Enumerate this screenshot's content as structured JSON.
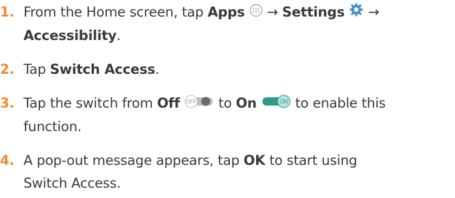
{
  "steps": [
    {
      "number": "1.",
      "t1": "From the Home screen, tap ",
      "b1": "Apps",
      "arrow1": "→",
      "b2": "Settings",
      "arrow2": "→",
      "b3": "Accessibility",
      "t2": "."
    },
    {
      "number": "2.",
      "t1": "Tap ",
      "b1": "Switch Access",
      "t2": "."
    },
    {
      "number": "3.",
      "t1": "Tap the switch from ",
      "b1": "Off",
      "toggle_off_text": "OFF",
      "t2": " to ",
      "b2": "On",
      "toggle_on_text": "ON",
      "t3": " to enable this",
      "t4": "function."
    },
    {
      "number": "4.",
      "t1": "A pop-out message appears, tap ",
      "b1": "OK",
      "t2": " to start using",
      "t3": "Switch Access."
    }
  ],
  "icons": [
    "apps-icon",
    "settings-gear-icon",
    "toggle-off-icon",
    "toggle-on-icon"
  ],
  "colors": {
    "accent": "#f08a2e",
    "text": "#3a3a3a",
    "toggle_on": "#2e9a8e",
    "toggle_off": "#bdbdbd",
    "gear": "#4a90c8"
  }
}
